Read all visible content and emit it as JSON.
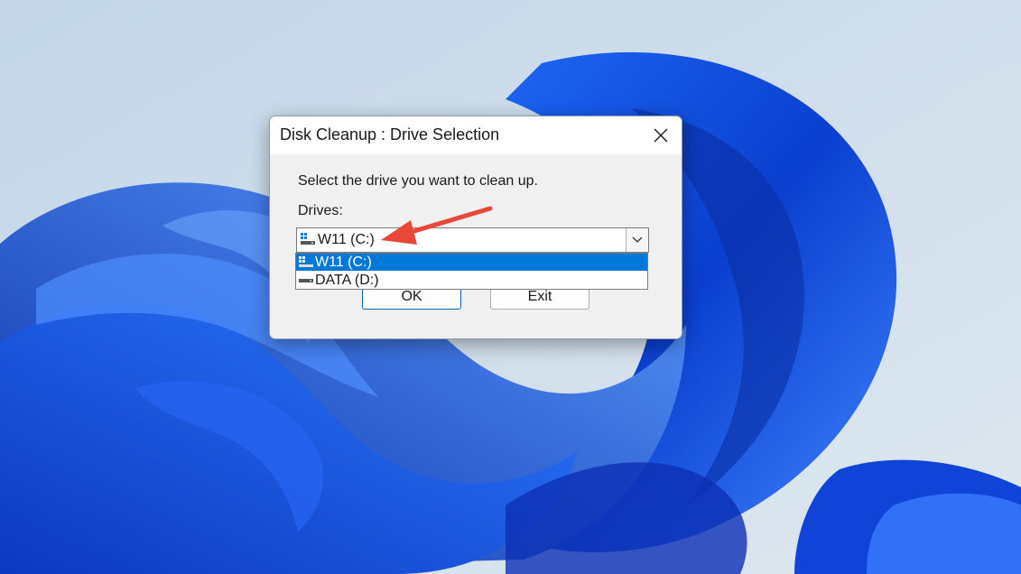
{
  "dialog": {
    "title": "Disk Cleanup : Drive Selection",
    "instruction": "Select the drive you want to clean up.",
    "drives_label": "Drives:",
    "selected_drive": "W11 (C:)",
    "options": [
      "W11 (C:)",
      "DATA (D:)"
    ],
    "ok_label": "OK",
    "exit_label": "Exit"
  },
  "colors": {
    "accent": "#0078d7",
    "annotation_arrow": "#e8473a",
    "wallpaper_blue": "#1a56e0"
  },
  "icons": [
    "close-icon",
    "chevron-down-icon",
    "windows-drive-icon",
    "drive-icon",
    "arrow-annotation"
  ]
}
